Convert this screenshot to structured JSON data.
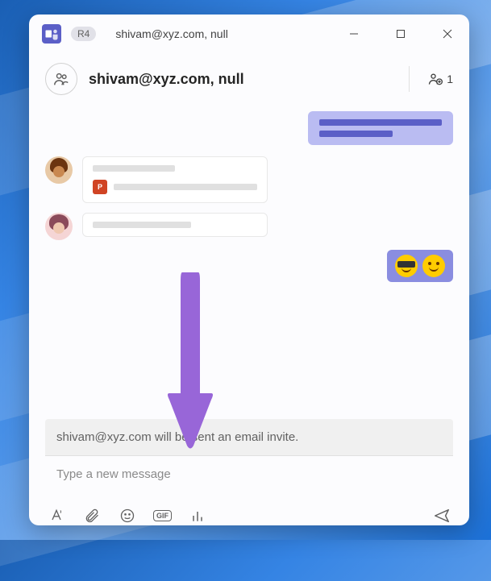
{
  "titlebar": {
    "badge": "R4",
    "title": "shivam@xyz.com, null"
  },
  "header": {
    "chat_title": "shivam@xyz.com, null",
    "participant_count": "1"
  },
  "messages": {
    "file_name_placeholder": "",
    "ppt_label": "P"
  },
  "compose": {
    "invite_notice": "shivam@xyz.com will be sent an email invite.",
    "placeholder": "Type a new message"
  },
  "toolbar": {
    "gif_label": "GIF"
  }
}
